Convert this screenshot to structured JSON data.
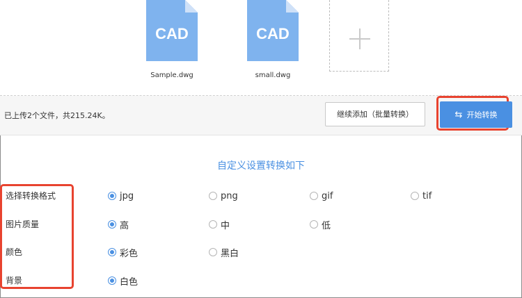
{
  "files": [
    {
      "name": "Sample.dwg",
      "icon_text": "CAD",
      "icon": "cad-file-icon"
    },
    {
      "name": "small.dwg",
      "icon_text": "CAD",
      "icon": "cad-file-icon"
    }
  ],
  "add_icon": "plus-icon",
  "action_bar": {
    "summary": "已上传2个文件，共215.24K。",
    "add_more_label": "继续添加（批量转换）",
    "start_label": "开始转换",
    "start_icon": "swap-icon"
  },
  "settings": {
    "title": "自定义设置转换如下",
    "rows": [
      {
        "label": "选择转换格式",
        "options": [
          "jpg",
          "png",
          "gif",
          "tif"
        ],
        "selected": "jpg"
      },
      {
        "label": "图片质量",
        "options": [
          "高",
          "中",
          "低"
        ],
        "selected": "高"
      },
      {
        "label": "颜色",
        "options": [
          "彩色",
          "黑白"
        ],
        "selected": "彩色"
      },
      {
        "label": "背景",
        "options": [
          "白色"
        ],
        "selected": "白色"
      }
    ]
  },
  "colors": {
    "accent": "#4a90e2",
    "file_icon": "#7fb3ee",
    "highlight": "#e8432f"
  }
}
